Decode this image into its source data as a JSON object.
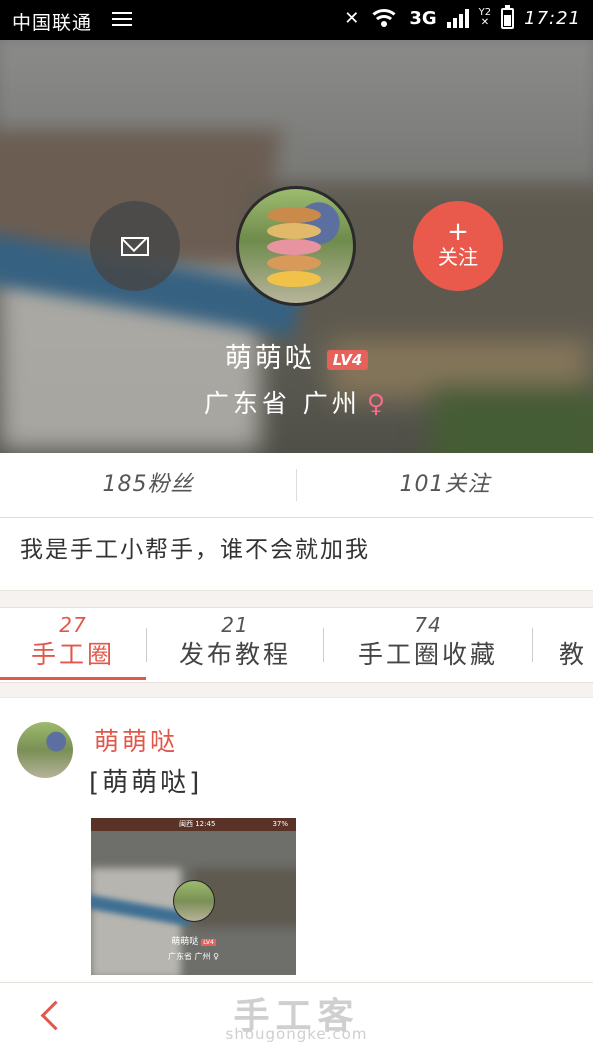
{
  "status_bar": {
    "carrier": "中国联通",
    "network": "3G",
    "sim1": "Y1",
    "sim2": "Y2",
    "time": "17:21",
    "icons": [
      "menu-icon",
      "mute-icon",
      "wifi-icon",
      "signal-icon",
      "battery-icon"
    ]
  },
  "profile": {
    "username": "萌萌哒",
    "level": "LV4",
    "location": "广东省 广州",
    "gender_symbol": "♀",
    "follow_plus": "+",
    "follow_label": "关注",
    "message_icon": "envelope-icon"
  },
  "stats": {
    "fans": "185粉丝",
    "following": "101关注"
  },
  "bio": "我是手工小帮手，谁不会就加我",
  "tabs": [
    {
      "count": "27",
      "label": "手工圈",
      "active": true
    },
    {
      "count": "21",
      "label": "发布教程",
      "active": false
    },
    {
      "count": "74",
      "label": "手工圈收藏",
      "active": false
    },
    {
      "count": "",
      "label": "教",
      "active": false
    }
  ],
  "post": {
    "author": "萌萌哒",
    "text": "[萌萌哒]",
    "image": {
      "status_carrier": "闽西 12:45",
      "status_battery": "37%",
      "name": "萌萌哒",
      "level": "LV4",
      "location": "广东省 广州 ♀"
    }
  },
  "watermark": {
    "cn": "手工客",
    "en": "shougongke.com"
  },
  "colors": {
    "accent": "#e0584b",
    "follow_button": "#ea5a4c",
    "gender": "#f46a8a"
  }
}
